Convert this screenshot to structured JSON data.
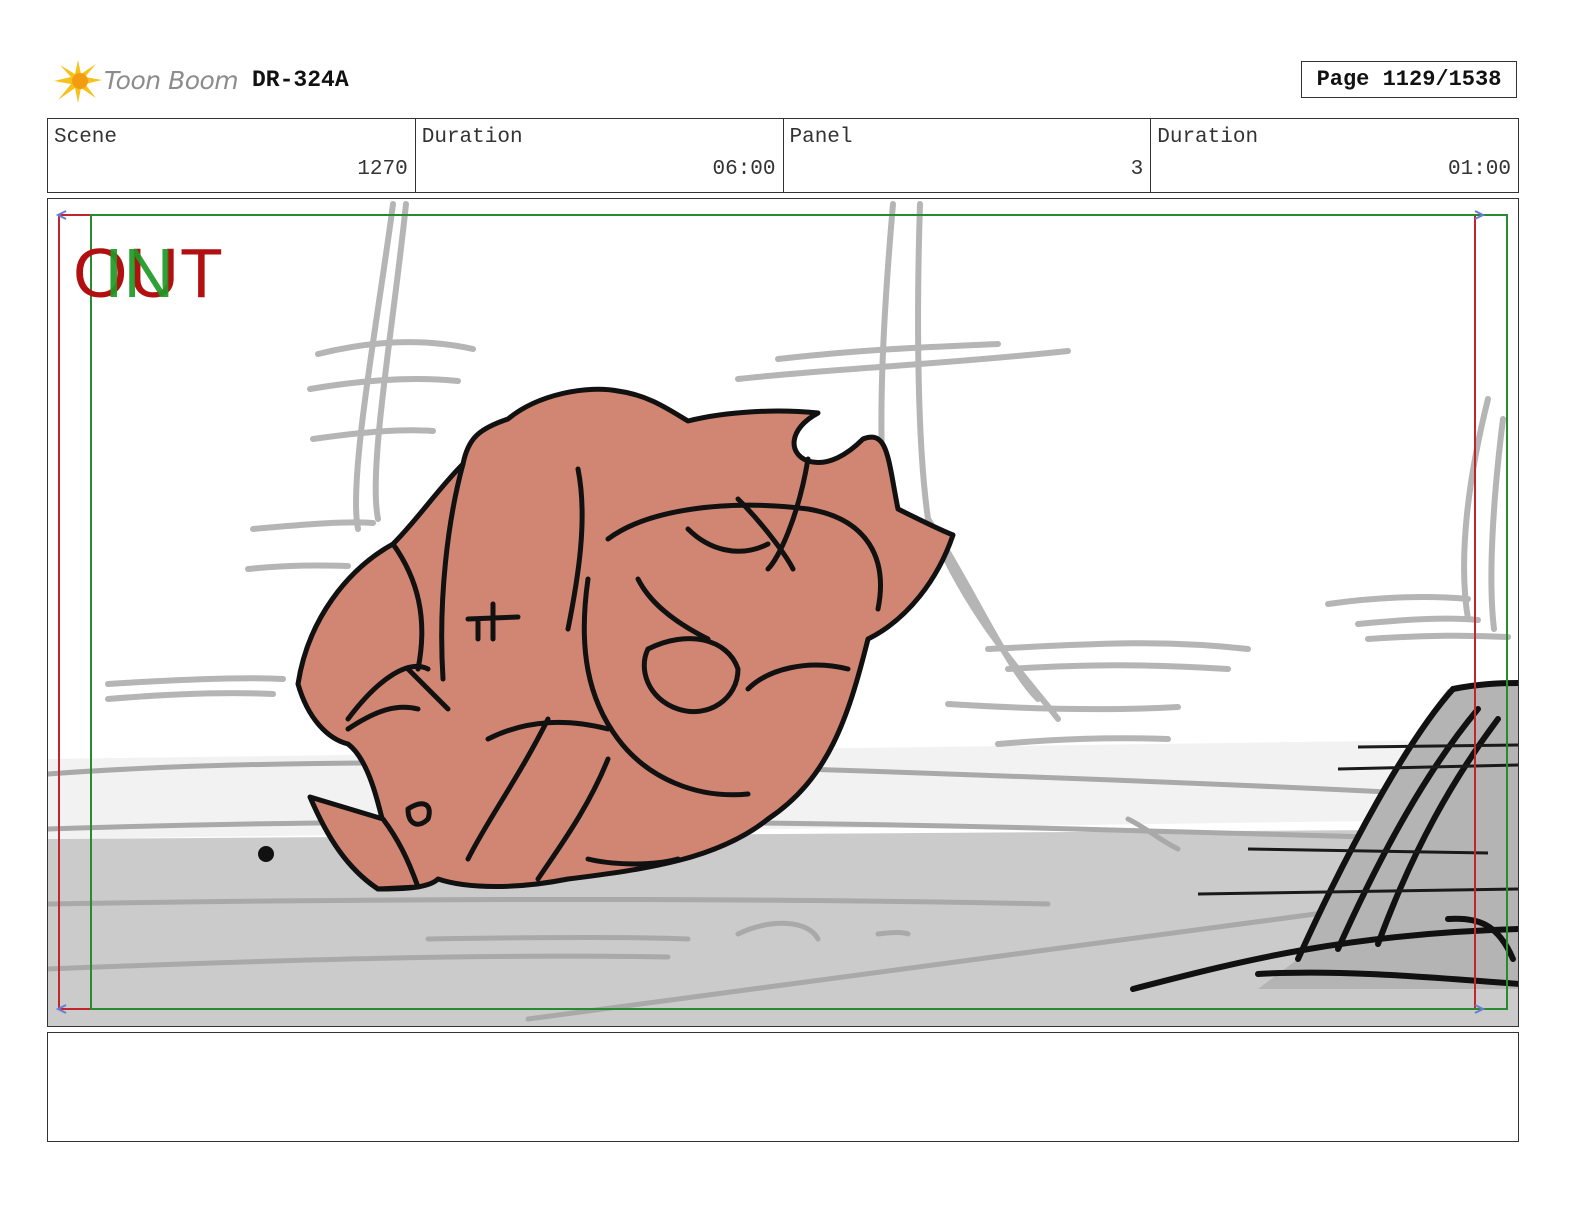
{
  "header": {
    "logo_text": "Toon Boom",
    "doc_id": "DR-324A",
    "page_label": "Page 1129/1538"
  },
  "info": [
    {
      "label": "Scene",
      "value": "1270"
    },
    {
      "label": "Duration",
      "value": "06:00"
    },
    {
      "label": "Panel",
      "value": "3"
    },
    {
      "label": "Duration",
      "value": "01:00"
    }
  ],
  "panel": {
    "in_marker": "IN",
    "out_marker": "OUT",
    "colors": {
      "out_frame": "#c0262d",
      "in_frame": "#2a8a2f",
      "character_fill": "#d08672",
      "ground": "#cbcbcb",
      "sketch_gray": "#b9b9b9"
    }
  },
  "notes": {
    "text": ""
  }
}
